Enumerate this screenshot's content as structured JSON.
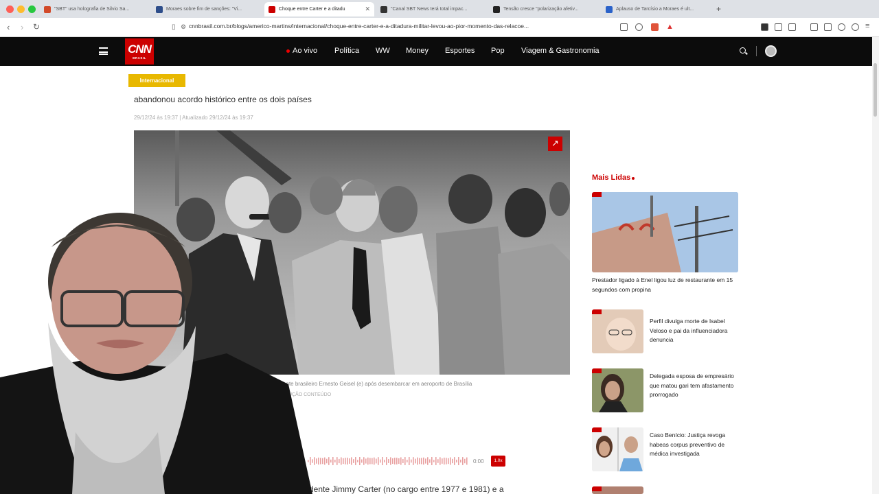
{
  "browser": {
    "tabs": [
      {
        "title": "\"SBT\" usa holografia de Silvio Sa..."
      },
      {
        "title": "Moraes sobre fim de sanções: \"Vi..."
      },
      {
        "title": "Choque entre Carter e a ditadu"
      },
      {
        "title": "\"Canal SBT News terá total impac..."
      },
      {
        "title": "Tensão cresce \"polarização afetiv..."
      },
      {
        "title": "Aplauso de Tarcísio a Moraes é ult..."
      }
    ],
    "url": "cnnbrasil.com.br/blogs/americo-martins/internacional/choque-entre-carter-e-a-ditadura-militar-levou-ao-pior-momento-das-relacoe..."
  },
  "site": {
    "logo_top": "CNN",
    "logo_bottom": "BRASIL",
    "nav": [
      "Ao vivo",
      "Política",
      "WW",
      "Money",
      "Esportes",
      "Pop",
      "Viagem & Gastronomia"
    ]
  },
  "article": {
    "section": "Internacional",
    "subhead": "abandonou acordo histórico entre os dois países",
    "date": "29/12/24 às 19:37 | Atualizado 29/12/24 às 19:37",
    "caption": "recebido pelo presidente brasileiro Ernesto Geisel (e) após desembarcar em aeroporto de Brasília",
    "credit": "REPRODUÇÃO CONTEÚDO",
    "audio_time": "0:00",
    "audio_speed": "1.0x",
    "body_start": "dente Jimmy Carter (no cargo entre 1977 e 1981) e a"
  },
  "sidebar": {
    "heading": "Mais Lidas",
    "items": [
      {
        "title": "Prestador ligado à Enel ligou luz de restaurante em 15 segundos com propina"
      },
      {
        "title": "Perfil divulga morte de Isabel Veloso e pai da influenciadora denuncia"
      },
      {
        "title": "Delegada esposa de empresário que matou gari tem afastamento prorrogado"
      },
      {
        "title": "Caso Benício: Justiça revoga habeas corpus preventivo de médica investigada"
      }
    ]
  },
  "colors": {
    "brand": "#cc0000",
    "nav_bg": "#0c0c0c",
    "badge": "#e8b800"
  }
}
